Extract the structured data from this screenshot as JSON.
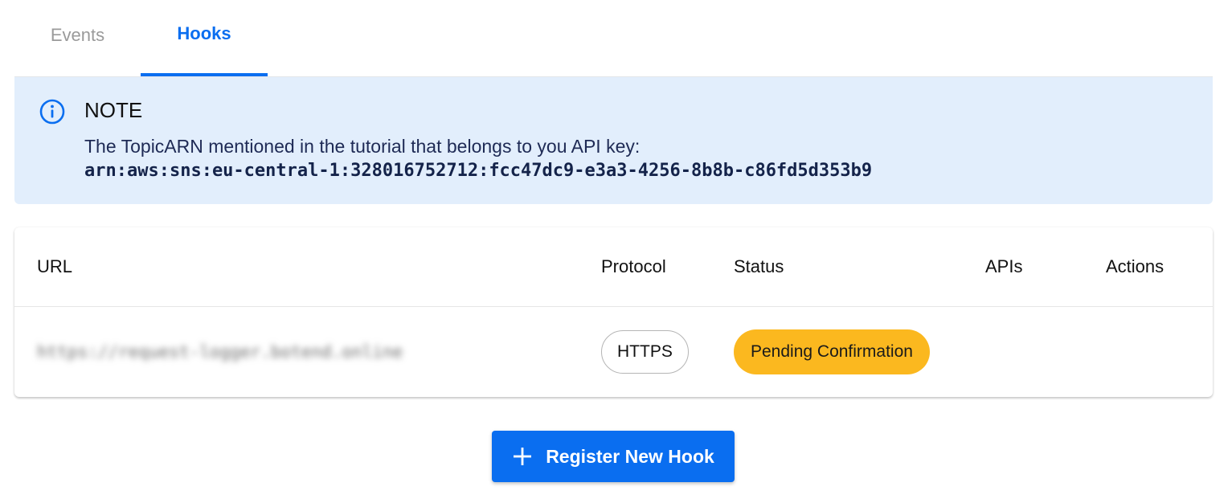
{
  "tabs": [
    {
      "label": "Events",
      "active": false
    },
    {
      "label": "Hooks",
      "active": true
    }
  ],
  "note": {
    "icon": "info-icon",
    "title": "NOTE",
    "text": "The TopicARN mentioned in the tutorial that belongs to you API key:",
    "arn": "arn:aws:sns:eu-central-1:328016752712:fcc47dc9-e3a3-4256-8b8b-c86fd5d353b9"
  },
  "table": {
    "columns": {
      "url": "URL",
      "protocol": "Protocol",
      "status": "Status",
      "apis": "APIs",
      "actions": "Actions"
    },
    "rows": [
      {
        "url": "https://request-logger.botend.online",
        "protocol": "HTTPS",
        "status": "Pending Confirmation",
        "apis": "",
        "actions": ""
      }
    ]
  },
  "register_button": {
    "icon": "plus-icon",
    "label": "Register New Hook"
  },
  "colors": {
    "accent": "#0a6ef0",
    "note_background": "#e2eefc",
    "status_pending": "#fbb81f"
  }
}
